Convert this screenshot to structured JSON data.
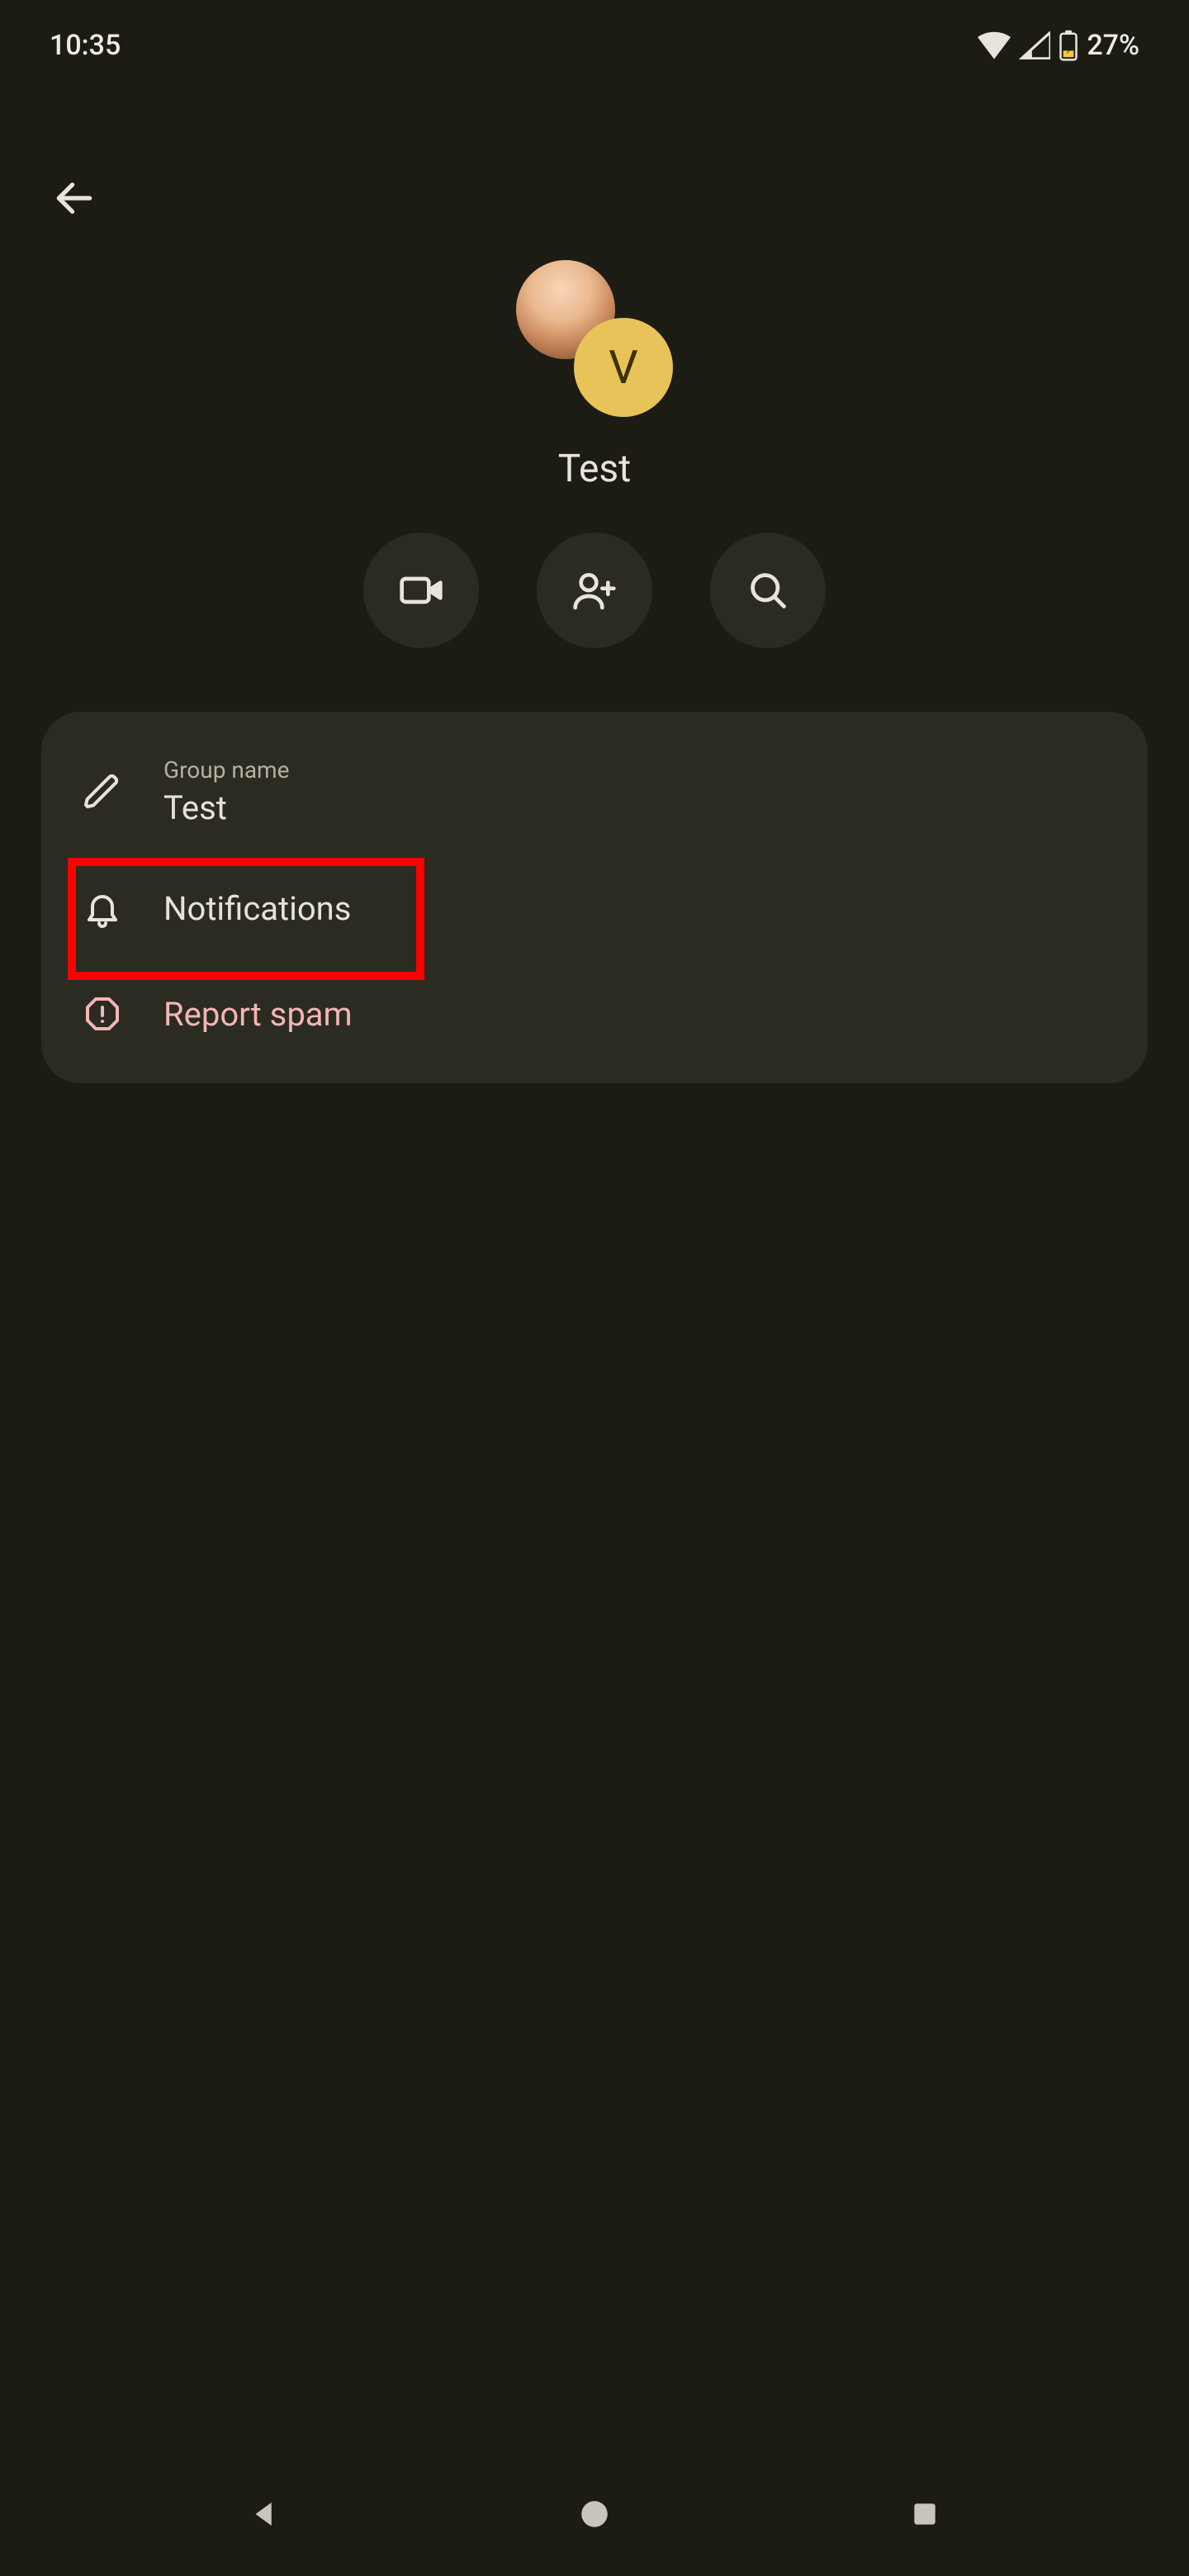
{
  "status": {
    "time": "10:35",
    "battery_pct": "27%"
  },
  "group": {
    "title": "Test",
    "secondary_avatar_initial": "V"
  },
  "card": {
    "group_name_label": "Group name",
    "group_name_value": "Test",
    "notifications_label": "Notifications",
    "report_spam_label": "Report spam"
  }
}
